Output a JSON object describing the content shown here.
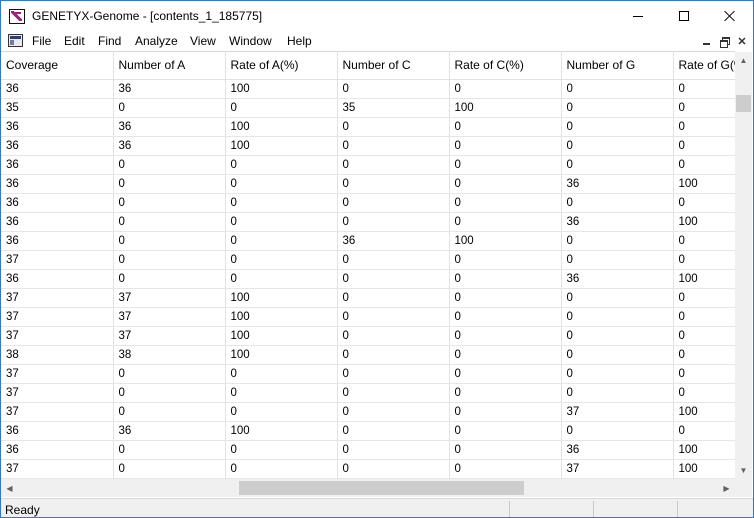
{
  "window": {
    "title": "GENETYX-Genome - [contents_1_185775]",
    "icon": "genetyx-app-icon"
  },
  "menu": {
    "items": [
      "File",
      "Edit",
      "Find",
      "Analyze",
      "View",
      "Window",
      "Help"
    ]
  },
  "table": {
    "columns": [
      "Coverage",
      "Number of A",
      "Rate of A(%)",
      "Number of C",
      "Rate of C(%)",
      "Number of G",
      "Rate of G(%)"
    ],
    "rows": [
      [
        "36",
        "36",
        "100",
        "0",
        "0",
        "0",
        "0"
      ],
      [
        "35",
        "0",
        "0",
        "35",
        "100",
        "0",
        "0"
      ],
      [
        "36",
        "36",
        "100",
        "0",
        "0",
        "0",
        "0"
      ],
      [
        "36",
        "36",
        "100",
        "0",
        "0",
        "0",
        "0"
      ],
      [
        "36",
        "0",
        "0",
        "0",
        "0",
        "0",
        "0"
      ],
      [
        "36",
        "0",
        "0",
        "0",
        "0",
        "36",
        "100"
      ],
      [
        "36",
        "0",
        "0",
        "0",
        "0",
        "0",
        "0"
      ],
      [
        "36",
        "0",
        "0",
        "0",
        "0",
        "36",
        "100"
      ],
      [
        "36",
        "0",
        "0",
        "36",
        "100",
        "0",
        "0"
      ],
      [
        "37",
        "0",
        "0",
        "0",
        "0",
        "0",
        "0"
      ],
      [
        "36",
        "0",
        "0",
        "0",
        "0",
        "36",
        "100"
      ],
      [
        "37",
        "37",
        "100",
        "0",
        "0",
        "0",
        "0"
      ],
      [
        "37",
        "37",
        "100",
        "0",
        "0",
        "0",
        "0"
      ],
      [
        "37",
        "37",
        "100",
        "0",
        "0",
        "0",
        "0"
      ],
      [
        "38",
        "38",
        "100",
        "0",
        "0",
        "0",
        "0"
      ],
      [
        "37",
        "0",
        "0",
        "0",
        "0",
        "0",
        "0"
      ],
      [
        "37",
        "0",
        "0",
        "0",
        "0",
        "0",
        "0"
      ],
      [
        "37",
        "0",
        "0",
        "0",
        "0",
        "37",
        "100"
      ],
      [
        "36",
        "36",
        "100",
        "0",
        "0",
        "0",
        "0"
      ],
      [
        "36",
        "0",
        "0",
        "0",
        "0",
        "36",
        "100"
      ],
      [
        "37",
        "0",
        "0",
        "0",
        "0",
        "37",
        "100"
      ]
    ]
  },
  "status": {
    "text": "Ready"
  }
}
